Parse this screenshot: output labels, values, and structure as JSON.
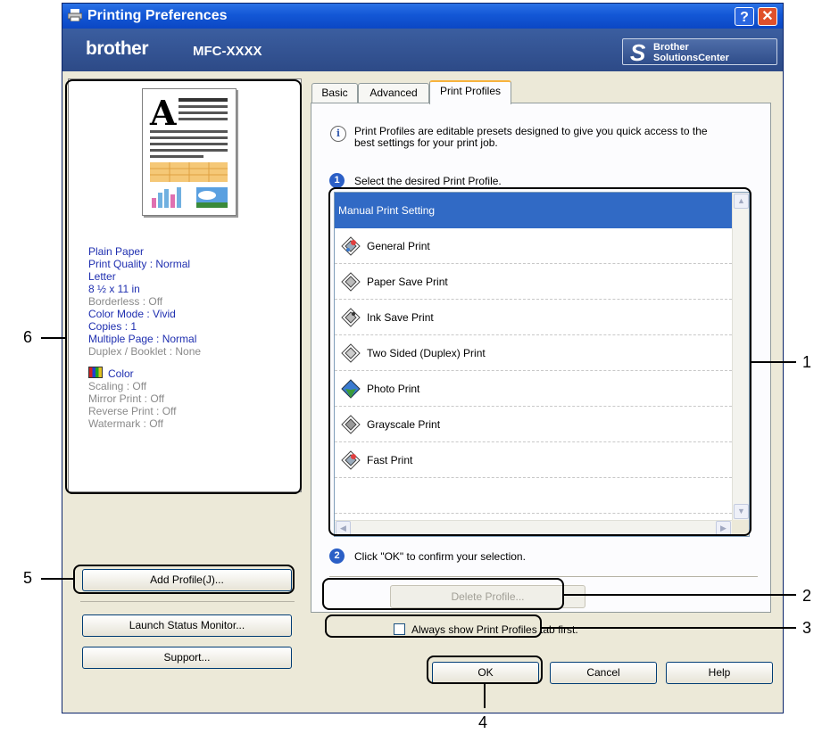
{
  "window": {
    "title": "Printing Preferences",
    "help_glyph": "?",
    "close_glyph": "✕"
  },
  "brand": {
    "logo": "brother",
    "model": "MFC-XXXX",
    "solutions_logo": "S",
    "solutions_line1": "Brother",
    "solutions_line2": "SolutionsCenter"
  },
  "tabs": [
    {
      "label": "Basic"
    },
    {
      "label": "Advanced"
    },
    {
      "label": "Print Profiles"
    }
  ],
  "profiles_tab": {
    "info_icon": "i",
    "info_text_line1": "Print Profiles are editable presets designed to give you quick access to the",
    "info_text_line2": "best settings for your print job.",
    "step1_number": "1",
    "step1_text": "Select the desired Print Profile.",
    "step2_number": "2",
    "step2_text": "Click \"OK\" to confirm your selection.",
    "list": [
      {
        "label": "Manual Print Setting",
        "icon": "none"
      },
      {
        "label": "General Print",
        "icon": "printer-color-icon"
      },
      {
        "label": "Paper Save Print",
        "icon": "printer-gray-icon"
      },
      {
        "label": "Ink Save Print",
        "icon": "printer-gray-icon"
      },
      {
        "label": "Two Sided (Duplex) Print",
        "icon": "printer-gray-icon"
      },
      {
        "label": "Photo Print",
        "icon": "photo-diamond-icon"
      },
      {
        "label": "Grayscale Print",
        "icon": "printer-gray-icon"
      },
      {
        "label": "Fast Print",
        "icon": "printer-color-icon"
      }
    ],
    "delete_button": "Delete Profile...",
    "always_show_label": "Always show Print Profiles tab first.",
    "always_show_checked": false
  },
  "preview": {
    "big_letter": "A",
    "settings_active": [
      "Plain Paper",
      "Print Quality : Normal",
      "Letter",
      "8 ½ x 11 in"
    ],
    "settings_mid_dim": [
      "Borderless : Off"
    ],
    "settings_active2": [
      "Color Mode : Vivid",
      "Copies : 1",
      "Multiple Page : Normal"
    ],
    "settings_mid_dim2": [
      "Duplex / Booklet : None"
    ],
    "color_label": "Color",
    "settings_dim": [
      "Scaling : Off",
      "Mirror Print : Off",
      "Reverse Print : Off",
      "Watermark : Off"
    ]
  },
  "left_buttons": {
    "add_profile": "Add Profile(J)...",
    "launch_status": "Launch Status Monitor...",
    "support": "Support..."
  },
  "bottom_buttons": {
    "ok": "OK",
    "cancel": "Cancel",
    "help": "Help"
  },
  "callouts": {
    "c1": "1",
    "c2": "2",
    "c3": "3",
    "c4": "4",
    "c5": "5",
    "c6": "6"
  },
  "colors": {
    "title_bar": "#1357d6",
    "brand_bar": "#2d4a87",
    "selection": "#316ac5",
    "tab_highlight": "#f7b33d",
    "settings_text": "#1f2fb0"
  }
}
